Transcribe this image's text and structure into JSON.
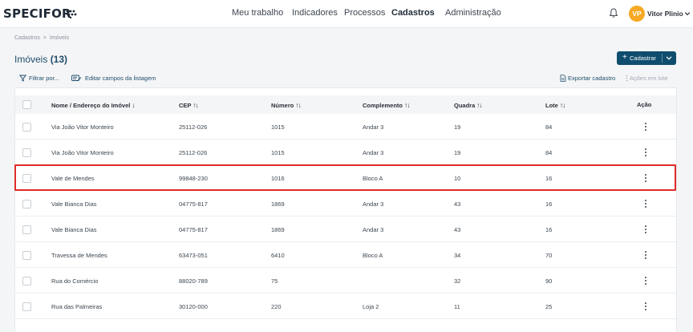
{
  "header": {
    "logo": "SPECIFOR",
    "nav": [
      "Meu trabalho",
      "Indicadores",
      "Processos",
      "Cadastros",
      "Administração"
    ],
    "active_nav": "Cadastros",
    "avatar_initials": "VP",
    "avatar_color": "#f7a823",
    "user_name": "Vitor Plinio"
  },
  "breadcrumb": [
    "Cadastros",
    "Imóveis"
  ],
  "page": {
    "title": "Imóveis",
    "count": "(13)",
    "primary_button": "Cadastrar",
    "accent": "#0f4d6e"
  },
  "toolbar": {
    "filter": "Filtrar por...",
    "edit_fields": "Editar campos da listagem",
    "export": "Exportar cadastro",
    "batch": "Ações em lote"
  },
  "table": {
    "columns": [
      "Nome / Endereço do Imóvel",
      "CEP",
      "Número",
      "Complemento",
      "Quadra",
      "Lote",
      "Ação"
    ],
    "rows": [
      [
        "Via João Vitor Monteiro",
        "25112-026",
        "1015",
        "Andar 3",
        "19",
        "84"
      ],
      [
        "Via João Vitor Monteiro",
        "25112-026",
        "1015",
        "Andar 3",
        "19",
        "84"
      ],
      [
        "Vale de Mendes",
        "99848-230",
        "1016",
        "Bloco A",
        "10",
        "16"
      ],
      [
        "Vale Bianca Dias",
        "04775-817",
        "1869",
        "Andar 3",
        "43",
        "16"
      ],
      [
        "Vale Bianca Dias",
        "04775-817",
        "1869",
        "Andar 3",
        "43",
        "16"
      ],
      [
        "Travessa de Mendes",
        "63473-051",
        "6410",
        "Bloco A",
        "34",
        "70"
      ],
      [
        "Rua do Comércio",
        "88020-789",
        "75",
        "",
        "32",
        "90"
      ],
      [
        "Rua das Palmeiras",
        "30120-000",
        "220",
        "Loja 2",
        "11",
        "25"
      ]
    ],
    "highlighted_row_index": 2,
    "highlight_color": "#e02b2b"
  }
}
